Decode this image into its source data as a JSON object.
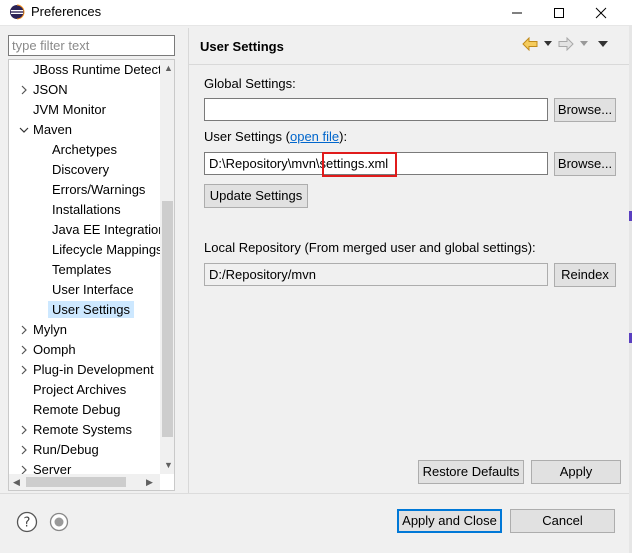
{
  "window": {
    "title": "Preferences",
    "app_icon": "eclipse-icon",
    "minimize_icon": "minimize-icon",
    "maximize_icon": "maximize-icon",
    "close_icon": "close-icon"
  },
  "sidebar": {
    "filter_placeholder": "type filter text",
    "items": [
      {
        "label": "JBoss Runtime Detection",
        "arrow": "none",
        "level": 0
      },
      {
        "label": "JSON",
        "arrow": "collapsed",
        "level": 0
      },
      {
        "label": "JVM Monitor",
        "arrow": "none",
        "level": 0
      },
      {
        "label": "Maven",
        "arrow": "expanded",
        "level": 0
      },
      {
        "label": "Archetypes",
        "arrow": "none",
        "level": 1
      },
      {
        "label": "Discovery",
        "arrow": "none",
        "level": 1
      },
      {
        "label": "Errors/Warnings",
        "arrow": "none",
        "level": 1
      },
      {
        "label": "Installations",
        "arrow": "none",
        "level": 1
      },
      {
        "label": "Java EE Integration",
        "arrow": "none",
        "level": 1
      },
      {
        "label": "Lifecycle Mappings",
        "arrow": "none",
        "level": 1
      },
      {
        "label": "Templates",
        "arrow": "none",
        "level": 1
      },
      {
        "label": "User Interface",
        "arrow": "none",
        "level": 1
      },
      {
        "label": "User Settings",
        "arrow": "none",
        "level": 1,
        "selected": true
      },
      {
        "label": "Mylyn",
        "arrow": "collapsed",
        "level": 0
      },
      {
        "label": "Oomph",
        "arrow": "collapsed",
        "level": 0
      },
      {
        "label": "Plug-in Development",
        "arrow": "collapsed",
        "level": 0
      },
      {
        "label": "Project Archives",
        "arrow": "none",
        "level": 0
      },
      {
        "label": "Remote Debug",
        "arrow": "none",
        "level": 0
      },
      {
        "label": "Remote Systems",
        "arrow": "collapsed",
        "level": 0
      },
      {
        "label": "Run/Debug",
        "arrow": "collapsed",
        "level": 0
      },
      {
        "label": "Server",
        "arrow": "collapsed",
        "level": 0
      }
    ]
  },
  "page": {
    "title": "User Settings",
    "back_icon": "back-arrow-icon",
    "forward_icon": "forward-arrow-icon",
    "menu_icon": "view-menu-icon",
    "global_settings_label": "Global Settings:",
    "global_settings_value": "",
    "browse_label": "Browse...",
    "user_settings_label_prefix": "User Settings (",
    "open_file_link": "open file",
    "user_settings_label_suffix": "):",
    "user_settings_value_prefix": "D:\\Repository\\mvn\\",
    "user_settings_value_highlight": "settings.xml",
    "update_settings_label": "Update Settings",
    "local_repo_label": "Local Repository (From merged user and global settings):",
    "local_repo_value": "D:/Repository/mvn",
    "reindex_label": "Reindex",
    "highlight_color": "#e01b1b"
  },
  "footer": {
    "restore_defaults_label": "Restore Defaults",
    "apply_label": "Apply",
    "apply_close_label": "Apply and Close",
    "cancel_label": "Cancel",
    "help_icon": "help-icon",
    "record_icon": "record-icon"
  }
}
